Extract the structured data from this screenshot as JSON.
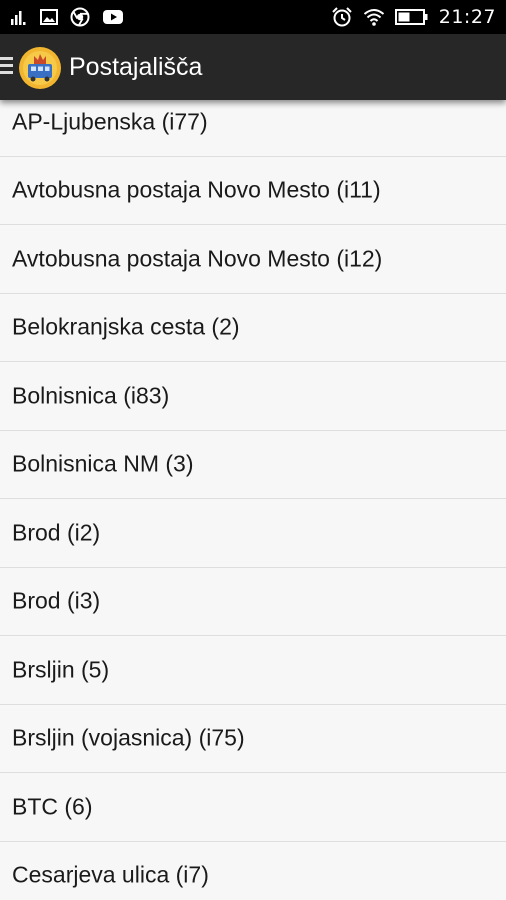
{
  "status_bar": {
    "time": "21:27",
    "icons": [
      "signal-icon",
      "image-icon",
      "chrome-icon",
      "youtube-icon",
      "alarm-icon",
      "wifi-icon",
      "battery-icon"
    ]
  },
  "app_bar": {
    "title": "Postajališča",
    "logo_icon": "app-logo-icon",
    "menu_icon": "hamburger-menu-icon"
  },
  "stations": [
    "AP-Ljubenska (i77)",
    "Avtobusna postaja Novo Mesto (i11)",
    "Avtobusna postaja Novo Mesto (i12)",
    "Belokranjska cesta (2)",
    "Bolnisnica (i83)",
    "Bolnisnica NM (3)",
    "Brod (i2)",
    "Brod (i3)",
    "Brsljin (5)",
    "Brsljin (vojasnica) (i75)",
    "BTC (6)",
    "Cesarjeva ulica (i7)"
  ],
  "colors": {
    "status_bar": "#000000",
    "app_bar": "#272727",
    "list_background": "#f7f7f7",
    "divider": "#dedede",
    "text": "#1a1a1a"
  }
}
